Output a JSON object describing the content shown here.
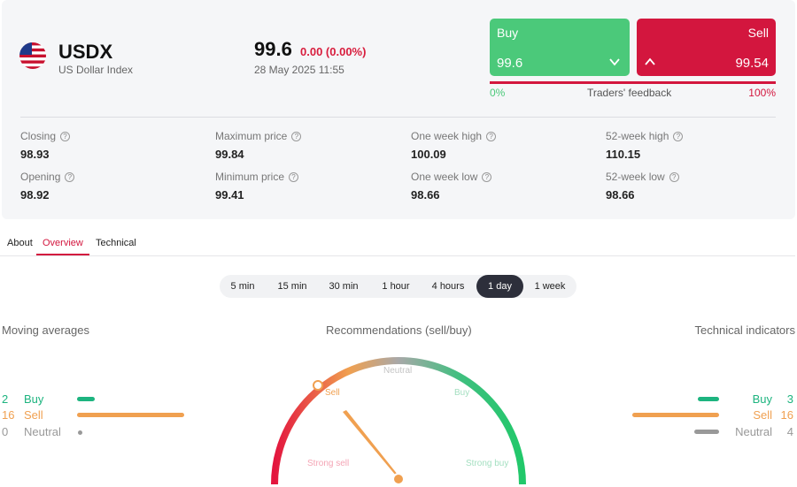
{
  "instrument": {
    "symbol": "USDX",
    "name": "US Dollar Index",
    "flag_icon": "us-flag-icon",
    "price": "99.6",
    "change": "0.00 (0.00%)",
    "timestamp": "28 May 2025 11:55"
  },
  "trade": {
    "buy_label": "Buy",
    "buy_price": "99.6",
    "sell_label": "Sell",
    "sell_price": "99.54",
    "feedback_low": "0%",
    "feedback_label": "Traders' feedback",
    "feedback_high": "100%",
    "buy_color": "#4bc97a",
    "sell_color": "#d3163e"
  },
  "stats": [
    {
      "label": "Closing",
      "value": "98.93"
    },
    {
      "label": "Maximum price",
      "value": "99.84"
    },
    {
      "label": "One week high",
      "value": "100.09"
    },
    {
      "label": "52-week high",
      "value": "110.15"
    },
    {
      "label": "Opening",
      "value": "98.92"
    },
    {
      "label": "Minimum price",
      "value": "99.41"
    },
    {
      "label": "One week low",
      "value": "98.66"
    },
    {
      "label": "52-week low",
      "value": "98.66"
    }
  ],
  "tabs": [
    {
      "label": "About",
      "active": false
    },
    {
      "label": "Overview",
      "active": true
    },
    {
      "label": "Technical",
      "active": false
    }
  ],
  "timeframes": [
    {
      "label": "5 min",
      "active": false
    },
    {
      "label": "15 min",
      "active": false
    },
    {
      "label": "30 min",
      "active": false
    },
    {
      "label": "1 hour",
      "active": false
    },
    {
      "label": "4 hours",
      "active": false
    },
    {
      "label": "1 day",
      "active": true
    },
    {
      "label": "1 week",
      "active": false
    }
  ],
  "moving_averages": {
    "title": "Moving averages",
    "buy_count": "2",
    "buy_label": "Buy",
    "sell_count": "16",
    "sell_label": "Sell",
    "neutral_count": "0",
    "neutral_label": "Neutral"
  },
  "technical_indicators": {
    "title": "Technical indicators",
    "buy_count": "3",
    "buy_label": "Buy",
    "sell_count": "16",
    "sell_label": "Sell",
    "neutral_count": "4",
    "neutral_label": "Neutral"
  },
  "recommendation": {
    "title": "Recommendations (sell/buy)",
    "labels": {
      "strong_sell": "Strong sell",
      "sell": "Sell",
      "neutral": "Neutral",
      "buy": "Buy",
      "strong_buy": "Strong buy"
    },
    "current": "Sell"
  }
}
